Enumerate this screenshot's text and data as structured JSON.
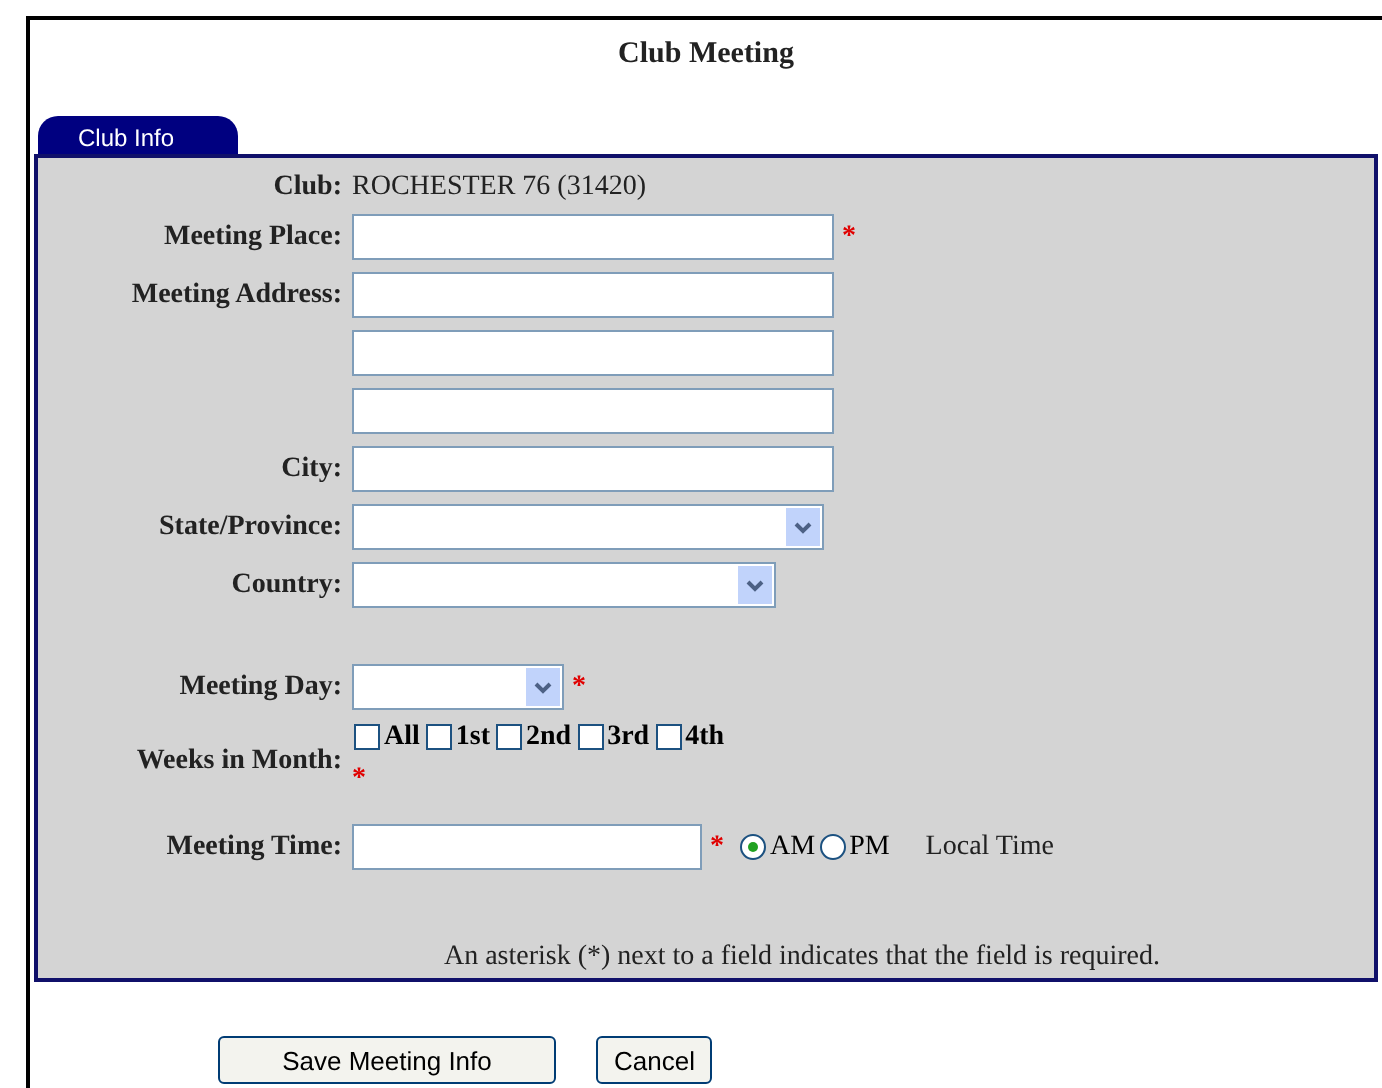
{
  "title": "Club Meeting",
  "tab": {
    "label": "Club Info",
    "selected": true
  },
  "club": {
    "label": "Club:",
    "value": "ROCHESTER 76 (31420)"
  },
  "address_fields": [
    {
      "kind": "text",
      "label": "Meeting Place:",
      "required_mark": "*"
    },
    {
      "kind": "text",
      "label": "Meeting Address:"
    },
    {
      "kind": "extra-line"
    },
    {
      "kind": "extra-line"
    },
    {
      "kind": "text",
      "label": "City:"
    },
    {
      "kind": "select",
      "label": "State/Province:"
    },
    {
      "kind": "select",
      "label": "Country:"
    }
  ],
  "schedule_fields": [
    {
      "kind": "select",
      "label": "Meeting Day:",
      "required_mark": "*"
    },
    {
      "kind": "checkboxes",
      "label": "Weeks in Month:",
      "required_mark": "*",
      "options": [
        {
          "label": "All",
          "checked": false
        },
        {
          "label": "1st",
          "checked": false
        },
        {
          "label": "2nd",
          "checked": false
        },
        {
          "label": "3rd",
          "checked": false
        },
        {
          "label": "4th",
          "checked": false
        }
      ]
    },
    {
      "kind": "time",
      "label": "Meeting Time:",
      "required_mark": "*",
      "options": [
        {
          "label": "AM",
          "selected": true
        },
        {
          "label": "PM",
          "selected": false
        }
      ],
      "note": "Local Time"
    }
  ],
  "required_note": "An asterisk (*) next to a field indicates that the field is required.",
  "buttons": [
    {
      "kind": "primary",
      "label": "Save Meeting Info"
    },
    {
      "kind": "secondary",
      "label": "Cancel"
    }
  ]
}
